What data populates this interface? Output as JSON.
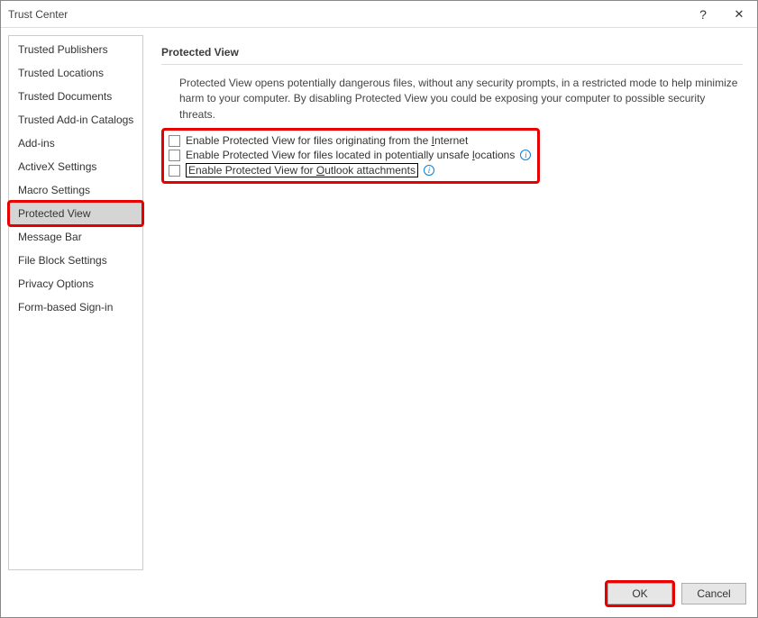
{
  "window": {
    "title": "Trust Center",
    "help_glyph": "?",
    "close_glyph": "✕"
  },
  "sidebar": {
    "items": [
      {
        "label": "Trusted Publishers",
        "selected": false
      },
      {
        "label": "Trusted Locations",
        "selected": false
      },
      {
        "label": "Trusted Documents",
        "selected": false
      },
      {
        "label": "Trusted Add-in Catalogs",
        "selected": false
      },
      {
        "label": "Add-ins",
        "selected": false
      },
      {
        "label": "ActiveX Settings",
        "selected": false
      },
      {
        "label": "Macro Settings",
        "selected": false
      },
      {
        "label": "Protected View",
        "selected": true,
        "highlight": true
      },
      {
        "label": "Message Bar",
        "selected": false
      },
      {
        "label": "File Block Settings",
        "selected": false
      },
      {
        "label": "Privacy Options",
        "selected": false
      },
      {
        "label": "Form-based Sign-in",
        "selected": false
      }
    ]
  },
  "content": {
    "group_title": "Protected View",
    "description": "Protected View opens potentially dangerous files, without any security prompts, in a restricted mode to help minimize harm to your computer. By disabling Protected View you could be exposing your computer to possible security threats.",
    "options": [
      {
        "pre": "Enable Protected View for files originating from the ",
        "accel": "I",
        "post": "nternet",
        "checked": false,
        "info": false,
        "focused": false
      },
      {
        "pre": "Enable Protected View for files located in potentially unsafe ",
        "accel": "l",
        "post": "ocations",
        "checked": false,
        "info": true,
        "focused": false
      },
      {
        "pre": "Enable Protected View for ",
        "accel": "O",
        "post": "utlook attachments",
        "checked": false,
        "info": true,
        "focused": true
      }
    ]
  },
  "footer": {
    "ok_label": "OK",
    "cancel_label": "Cancel"
  }
}
